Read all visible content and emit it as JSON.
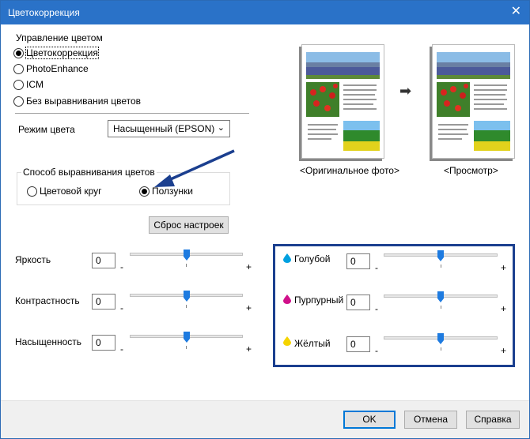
{
  "window": {
    "title": "Цветокоррекция",
    "close_glyph": "✕"
  },
  "color_management": {
    "group_label": "Управление цветом",
    "options": [
      {
        "label": "Цветокоррекция",
        "checked": true
      },
      {
        "label": "PhotoEnhance",
        "checked": false
      },
      {
        "label": "ICM",
        "checked": false
      },
      {
        "label": "Без выравнивания цветов",
        "checked": false
      }
    ]
  },
  "color_mode": {
    "label": "Режим цвета",
    "value": "Насыщенный (EPSON)"
  },
  "alignment": {
    "group_label": "Способ выравнивания цветов",
    "options": [
      {
        "label": "Цветовой круг",
        "checked": false
      },
      {
        "label": "Ползунки",
        "checked": true
      }
    ]
  },
  "reset_button": "Сброс настроек",
  "preview": {
    "original_label": "<Оригинальное фото>",
    "preview_label": "<Просмотр>",
    "arrow_glyph": "➡"
  },
  "left_sliders": [
    {
      "label": "Яркость",
      "value": "0",
      "minus": "-",
      "plus": "+",
      "level": 0.5
    },
    {
      "label": "Контрастность",
      "value": "0",
      "minus": "-",
      "plus": "+",
      "level": 0.5
    },
    {
      "label": "Насыщенность",
      "value": "0",
      "minus": "-",
      "plus": "+",
      "level": 0.5
    }
  ],
  "right_sliders": [
    {
      "label": "Голубой",
      "value": "0",
      "minus": "-",
      "plus": "+",
      "level": 0.5,
      "color": "#00a0e0"
    },
    {
      "label": "Пурпурный",
      "value": "0",
      "minus": "-",
      "plus": "+",
      "level": 0.5,
      "color": "#d0108a"
    },
    {
      "label": "Жёлтый",
      "value": "0",
      "minus": "-",
      "plus": "+",
      "level": 0.5,
      "color": "#f5d400"
    }
  ],
  "footer": {
    "ok": "OK",
    "cancel": "Отмена",
    "help": "Справка"
  },
  "colors": {
    "titlebar": "#2a72c8",
    "accent": "#0078d7",
    "annotation": "#1b3f8f",
    "thumb": "#1e7be0"
  }
}
